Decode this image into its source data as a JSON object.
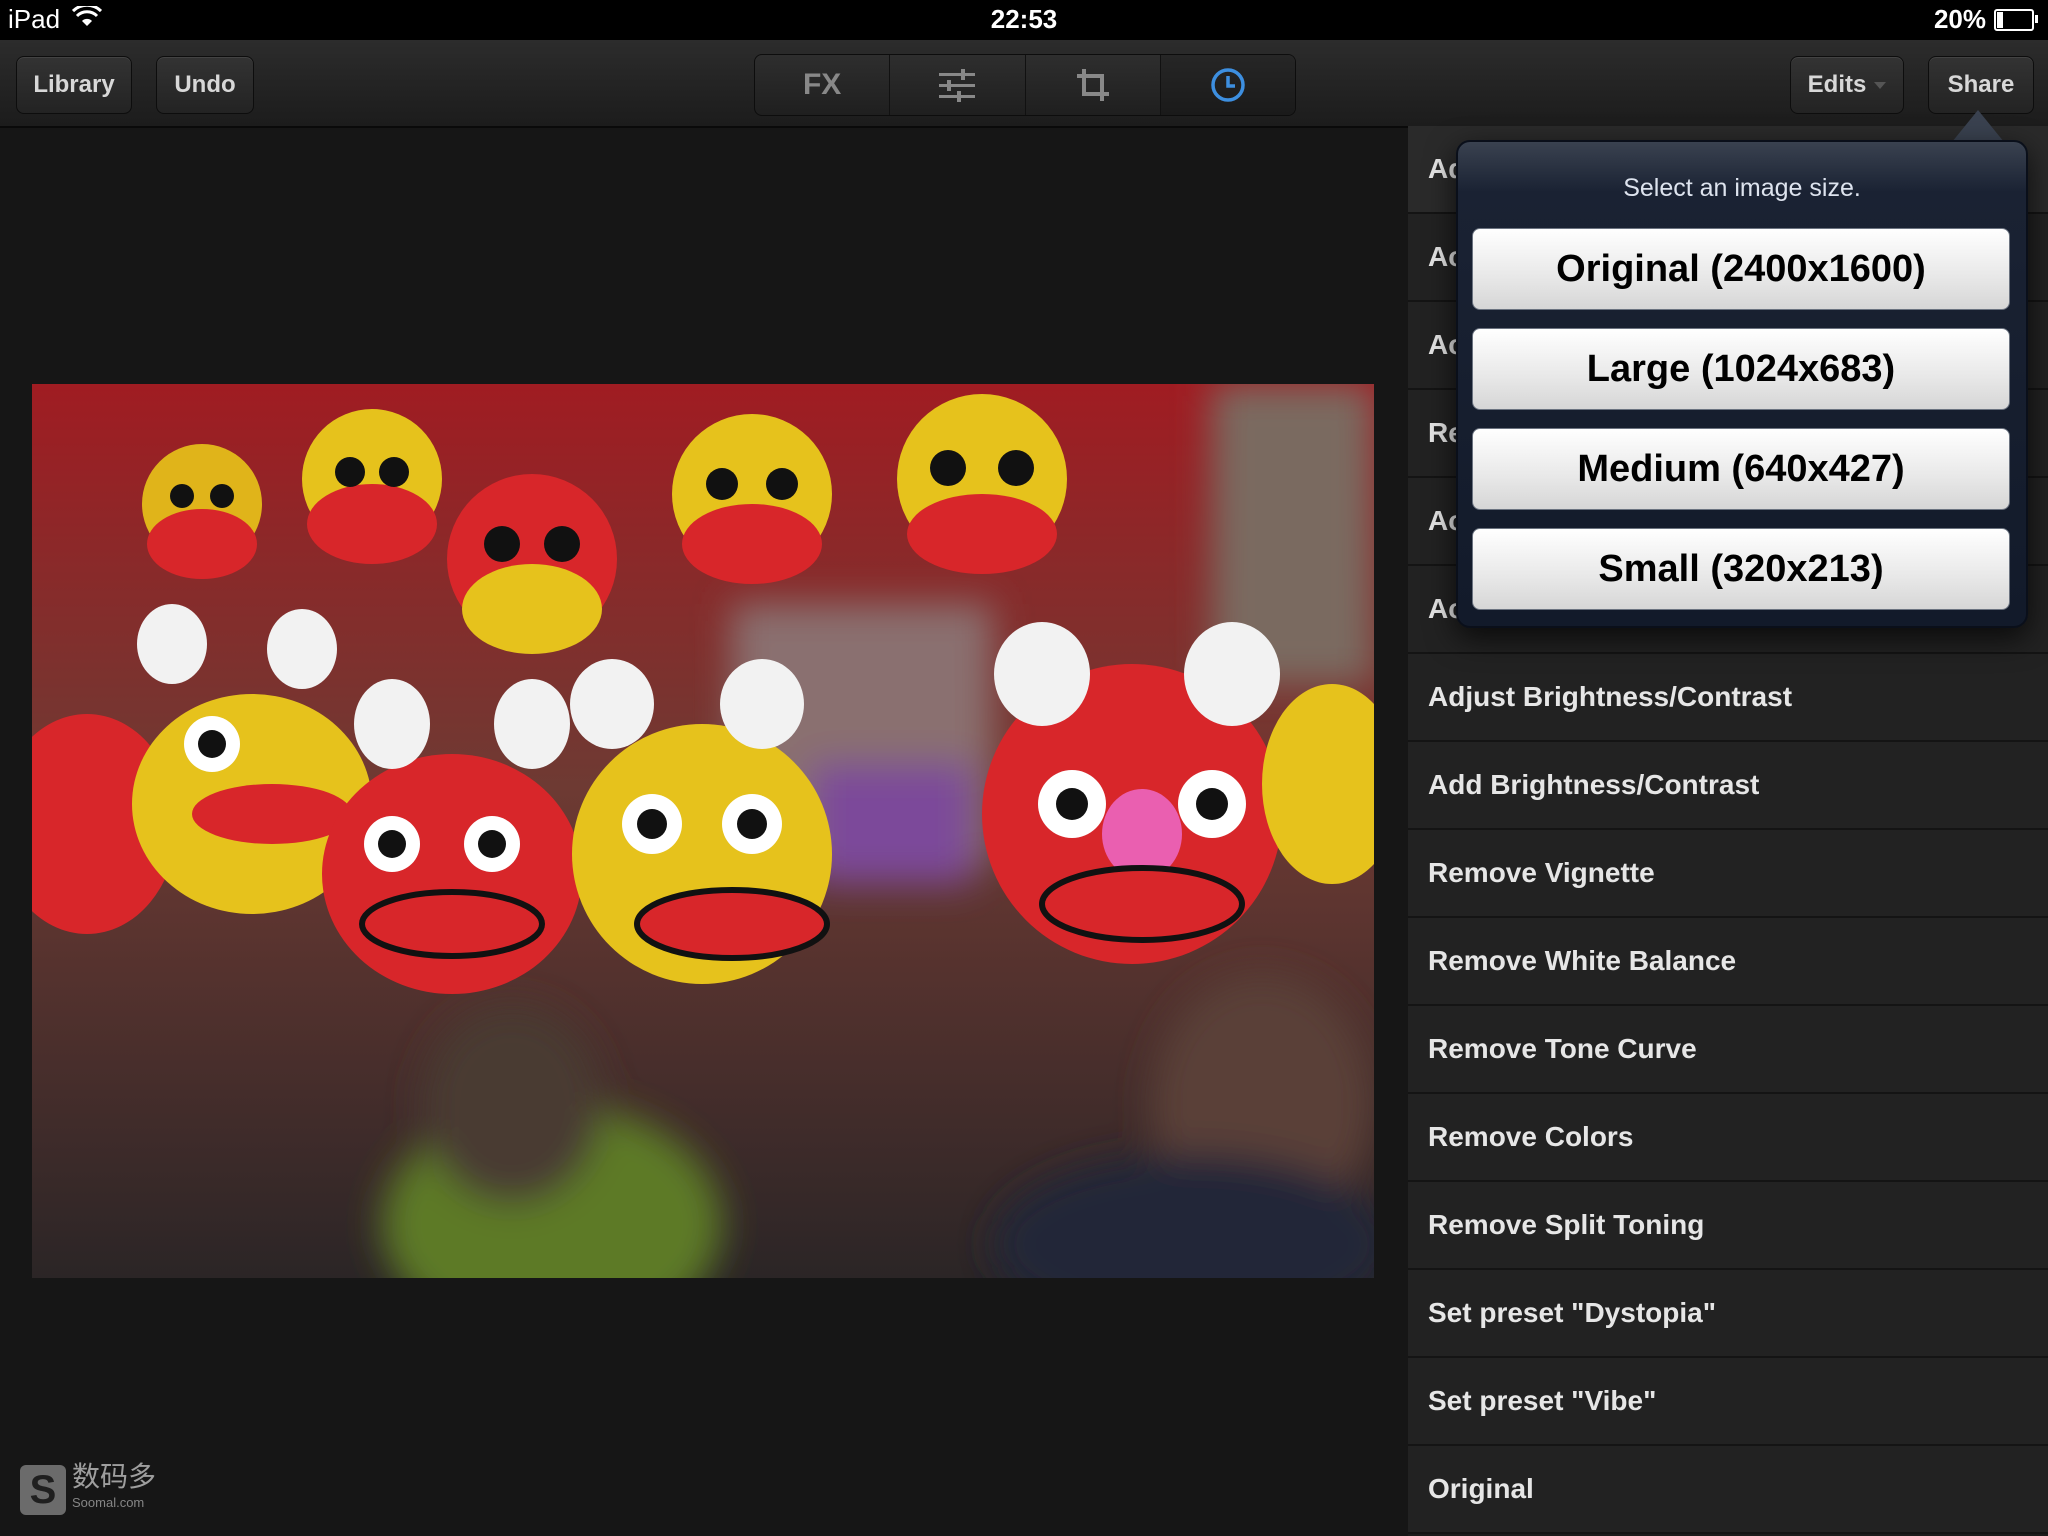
{
  "status_bar": {
    "device": "iPad",
    "time": "22:53",
    "battery": "20%",
    "battery_level": 0.2
  },
  "toolbar": {
    "library_label": "Library",
    "undo_label": "Undo",
    "fx_label": "FX",
    "edits_label": "Edits",
    "share_label": "Share",
    "icons": [
      "sliders-icon",
      "crop-icon",
      "history-clock-icon"
    ],
    "accent": "#3d8fe0"
  },
  "history": {
    "items": [
      "Add Colors",
      "Ac",
      "Ac",
      "Re",
      "Ac",
      "Ac",
      "Adjust Brightness/Contrast",
      "Add Brightness/Contrast",
      "Remove Vignette",
      "Remove White Balance",
      "Remove Tone Curve",
      "Remove Colors",
      "Remove Split Toning",
      "Set preset \"Dystopia\"",
      "Set preset \"Vibe\"",
      "Original"
    ]
  },
  "popover": {
    "title": "Select an image size.",
    "options": [
      "Original (2400x1600)",
      "Large (1024x683)",
      "Medium (640x427)",
      "Small (320x213)"
    ]
  },
  "watermark": {
    "text": "数码多",
    "sub": "Soomal.com"
  }
}
